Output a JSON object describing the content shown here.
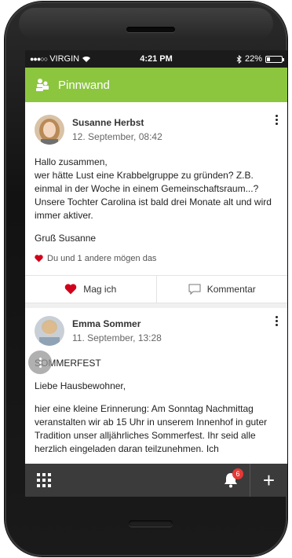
{
  "statusbar": {
    "carrier": "VIRGIN",
    "time": "4:21 PM",
    "battery": "22%",
    "battery_level": 0.22
  },
  "appbar": {
    "title": "Pinnwand",
    "color": "#8cc63f"
  },
  "posts": [
    {
      "author": "Susanne Herbst",
      "date": "12. September, 08:42",
      "paragraphs": [
        "Hallo zusammen,\nwer hätte Lust eine Krabbelgruppe zu gründen? Z.B. einmal in der Woche in einem Gemeinschaftsraum...? Unsere Tochter Carolina ist bald drei Monate alt und wird immer aktiver.",
        "Gruß Susanne"
      ],
      "likes_text": "Du und 1 andere mögen das",
      "like_label": "Mag ich",
      "comment_label": "Kommentar"
    },
    {
      "author": "Emma Sommer",
      "date": "11. September, 13:28",
      "paragraphs": [
        "SOMMERFEST",
        "Liebe Hausbewohner,",
        "hier eine kleine Erinnerung: Am Sonntag Nachmittag veranstalten wir ab 15 Uhr in unserem Innenhof in guter Tradition unser alljährliches Sommerfest. Ihr seid alle herzlich eingeladen daran teilzunehmen. Ich"
      ]
    }
  ],
  "bottombar": {
    "notification_count": "6",
    "plus_label": "+"
  },
  "colors": {
    "accent": "#8cc63f",
    "heart": "#d0021b",
    "bottombar": "#3b3b3b",
    "badge": "#e53935"
  }
}
